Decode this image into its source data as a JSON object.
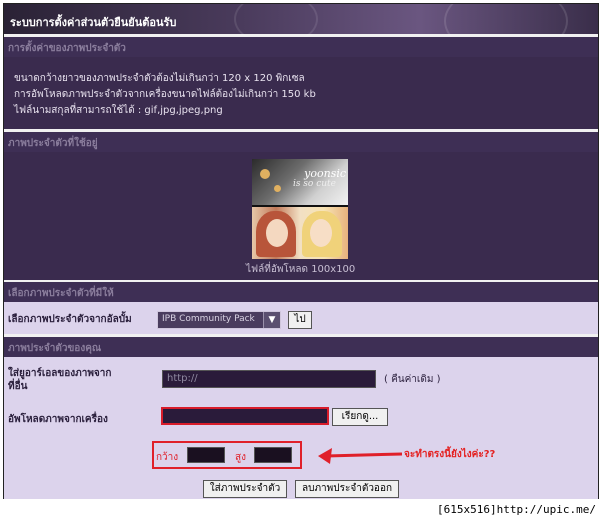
{
  "title": "ระบบการตั้งค่าส่วนตัวยืนยันต้อนรับ",
  "sections": {
    "settings": "การตั้งค่าของภาพประจำตัว",
    "current": "ภาพประจำตัวที่ใช้อยู่",
    "choose": "เลือกภาพประจำตัวที่มีให้",
    "own": "ภาพประจำตัวของคุณ"
  },
  "info_lines": [
    "ขนาดกว้างยาวของภาพประจำตัวต้องไม่เกินกว่า 120 x 120 พิกเซล",
    "การอัพโหลดภาพประจำตัวจากเครื่องขนาดไฟล์ต้องไม่เกินกว่า 150 kb",
    "ไฟล์นามสกุลที่สามารถใช้ได้ : gif,jpg,jpeg,png"
  ],
  "avatar": {
    "watermark1": "yoonsic",
    "watermark2": "is so cute",
    "caption": "ไฟล์ที่อัพโหลด 100x100"
  },
  "gallery": {
    "label": "เลือกภาพประจำตัวจากอัลบั้ม",
    "selected": "IPB Community Pack",
    "go_button": "ไป"
  },
  "own": {
    "url_label": "ใส่ยูอาร์เอลของภาพจากที่อื่น",
    "url_value": "http://",
    "reset_link": "( คืนค่าเดิม )",
    "upload_label": "อัพโหลดภาพจากเครื่อง",
    "browse_button": "เรียกดู...",
    "width_label": "กว้าง",
    "height_label": "สูง"
  },
  "annotation": "จะทำตรงนี้ยังไงค่ะ??",
  "buttons": {
    "save": "ใส่ภาพประจำตัว",
    "remove": "ลบภาพประจำตัวออก"
  },
  "watermark": "[615x516]http://upic.me/",
  "colors": {
    "panel_dark": "#3a2b4e",
    "panel_light": "#dcd3ec",
    "accent_red": "#e0202a"
  }
}
